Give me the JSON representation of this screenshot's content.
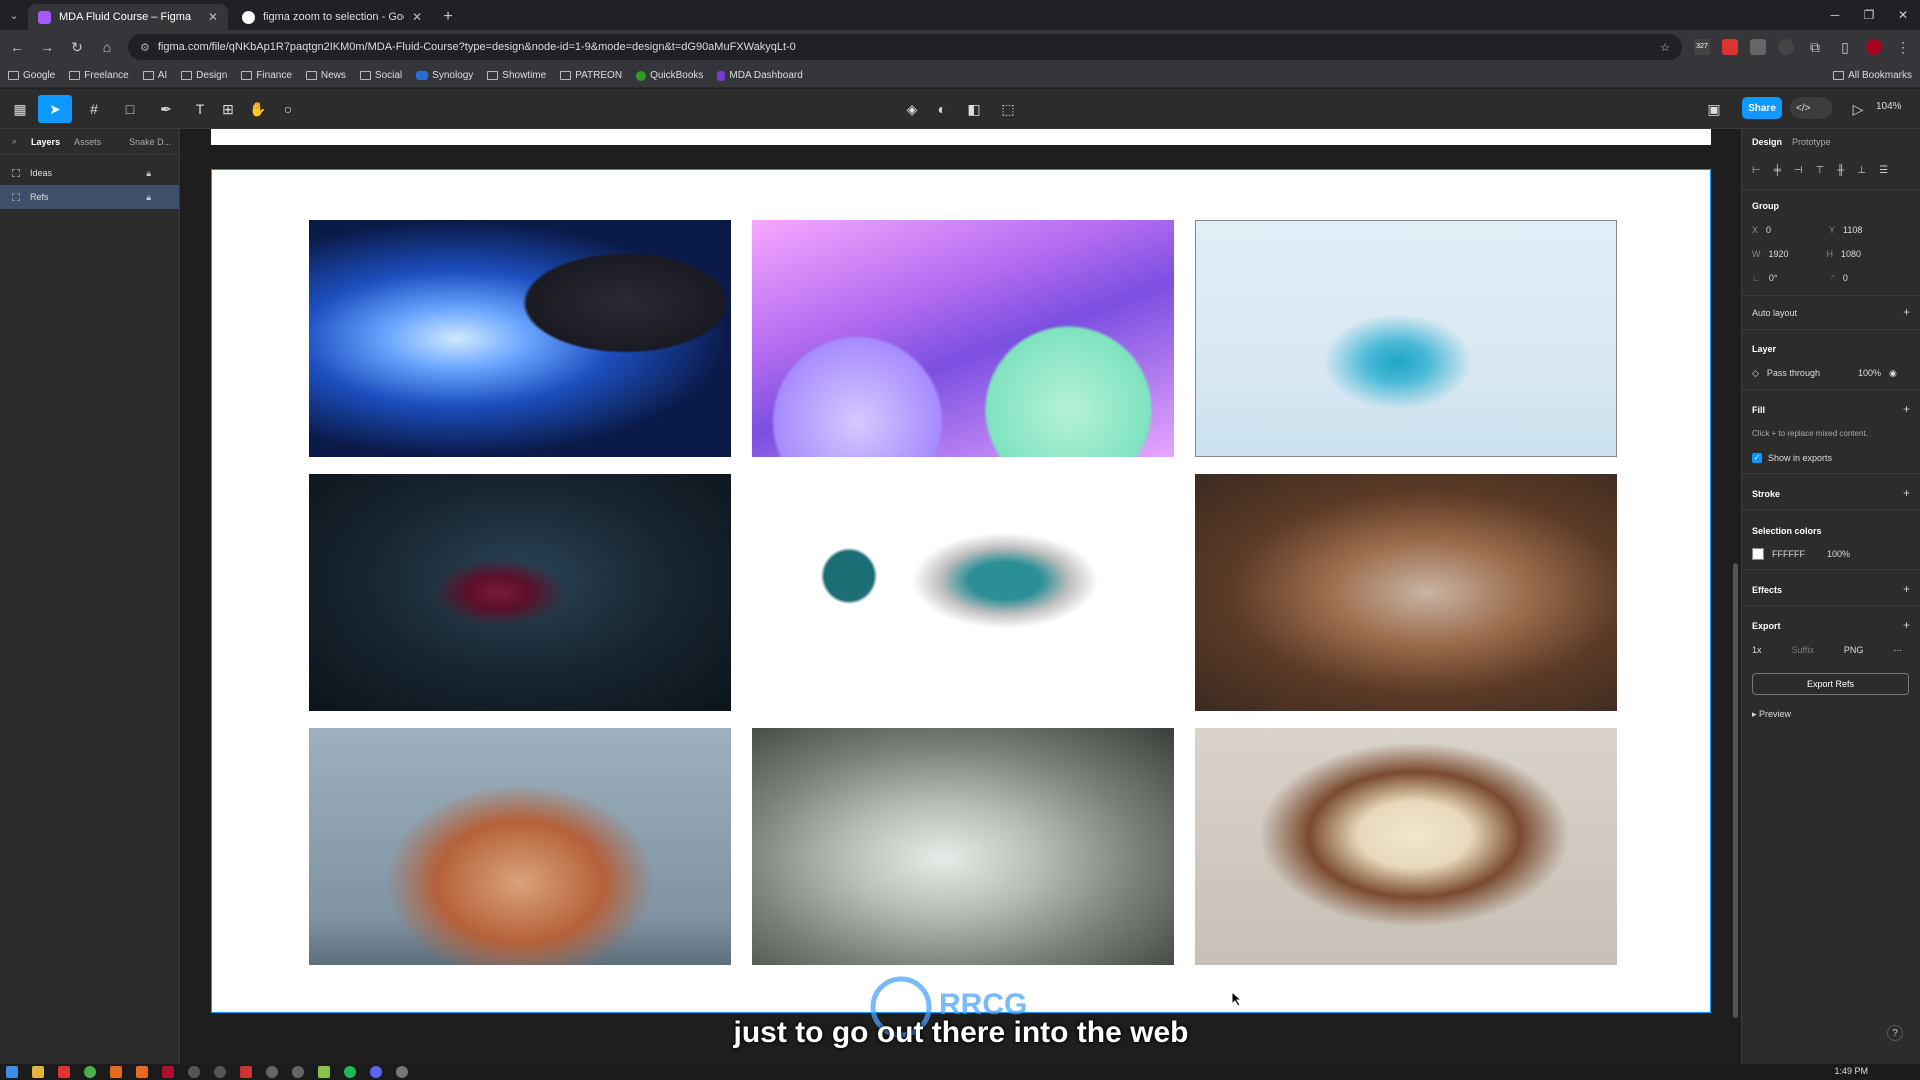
{
  "browser": {
    "tabs": [
      {
        "title": "MDA Fluid Course – Figma",
        "favicon_color": "#a259ff"
      },
      {
        "title": "figma zoom to selection - Goo",
        "favicon_color": "#ffffff"
      }
    ],
    "url": "figma.com/file/qNKbAp1R7paqtgn2IKM0m/MDA-Fluid-Course?type=design&node-id=1-9&mode=design&t=dG90aMuFXWakyqLt-0",
    "ext_badge": "327",
    "bookmarks": [
      "Google",
      "Freelance",
      "AI",
      "Design",
      "Finance",
      "News",
      "Social",
      "Synology",
      "Showtime",
      "PATREON",
      "QuickBooks",
      "MDA Dashboard"
    ],
    "all_bookmarks": "All Bookmarks"
  },
  "toolbar": {
    "share_label": "Share",
    "devmode_label": "</>",
    "zoom": "104%"
  },
  "left_panel": {
    "tabs": [
      "Layers",
      "Assets",
      "Snake D..."
    ],
    "layers": [
      {
        "name": "Ideas",
        "selected": false
      },
      {
        "name": "Refs",
        "selected": true
      }
    ]
  },
  "canvas": {
    "subtitle": "just to go out there into the web",
    "watermark": "RRCG"
  },
  "right_panel": {
    "tabs": [
      "Design",
      "Prototype"
    ],
    "group_label": "Group",
    "x": "0",
    "y": "1108",
    "w": "1920",
    "h": "1080",
    "rotation": "0°",
    "radius": "0",
    "auto_layout": "Auto layout",
    "layer_label": "Layer",
    "blend": "Pass through",
    "opacity": "100%",
    "fill_label": "Fill",
    "fill_hint": "Click + to replace mixed content.",
    "show_in_exports": "Show in exports",
    "stroke_label": "Stroke",
    "selection_colors": "Selection colors",
    "color_hex": "FFFFFF",
    "color_opacity": "100%",
    "effects": "Effects",
    "export_label": "Export",
    "export_scale": "1x",
    "export_suffix": "Suffix",
    "export_format": "PNG",
    "export_button": "Export Refs",
    "preview": "Preview"
  },
  "taskbar": {
    "time": "1:49 PM"
  }
}
